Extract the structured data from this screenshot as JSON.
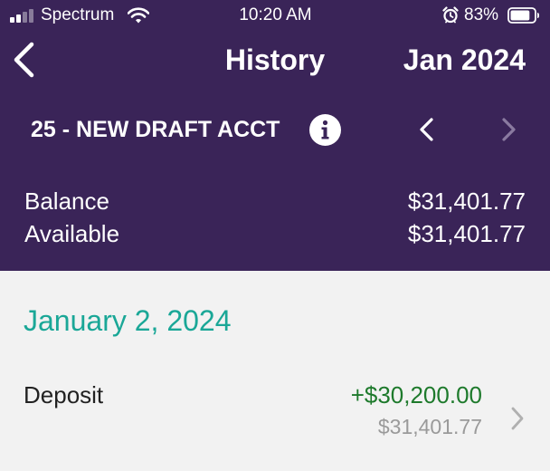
{
  "status_bar": {
    "carrier": "Spectrum",
    "time": "10:20 AM",
    "battery_percent": "83%",
    "battery_level": 0.83,
    "icons": [
      "signal-icon",
      "wifi-icon",
      "alarm-icon",
      "battery-icon"
    ]
  },
  "nav": {
    "back_icon": "chevron-left-icon",
    "title": "History",
    "month": "Jan 2024"
  },
  "account": {
    "name": "25 - NEW DRAFT ACCT",
    "info_icon": "info-icon",
    "prev_icon": "chevron-left-icon",
    "next_icon": "chevron-right-icon",
    "balance_label": "Balance",
    "balance_value": "$31,401.77",
    "available_label": "Available",
    "available_value": "$31,401.77"
  },
  "history": {
    "groups": [
      {
        "date": "January 2, 2024",
        "transactions": [
          {
            "description": "Deposit",
            "amount": "+$30,200.00",
            "running_balance": "$31,401.77"
          }
        ]
      }
    ]
  },
  "colors": {
    "header_bg": "#3a2458",
    "date_text": "#1aa797",
    "credit_amount": "#1e7a2c",
    "body_bg": "#f2f2f2"
  }
}
